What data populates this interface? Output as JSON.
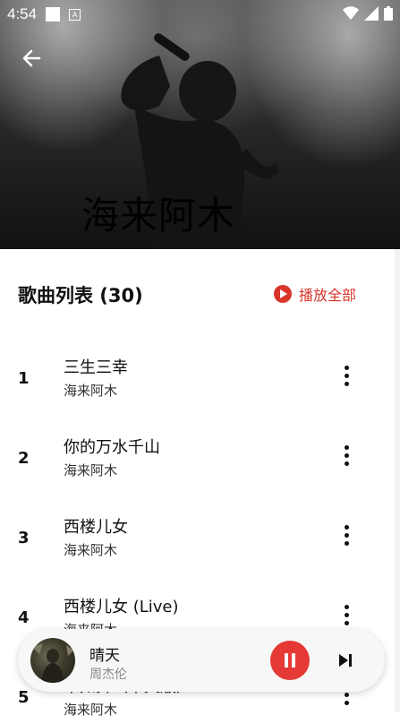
{
  "status_bar": {
    "time": "4:54",
    "notif_letter": "A"
  },
  "header": {
    "artist_name": "海来阿木"
  },
  "list": {
    "title": "歌曲列表 (30)",
    "play_all_label": "播放全部",
    "songs": [
      {
        "index": "1",
        "title": "三生三幸",
        "artist": "海来阿木"
      },
      {
        "index": "2",
        "title": "你的万水千山",
        "artist": "海来阿木"
      },
      {
        "index": "3",
        "title": "西楼儿女",
        "artist": "海来阿木"
      },
      {
        "index": "4",
        "title": "西楼儿女 (Live)",
        "artist": "海来阿木"
      },
      {
        "index": "5",
        "title": "不如舞（中文版）",
        "artist": "海来阿木"
      }
    ]
  },
  "player": {
    "title": "晴天",
    "artist": "周杰伦"
  },
  "colors": {
    "accent": "#d9352b",
    "pause_button": "#e53935"
  },
  "icons": {
    "back": "arrow-left-icon",
    "play_all": "play-circle-icon",
    "more": "more-vert-icon",
    "pause": "pause-icon",
    "next": "skip-next-icon"
  }
}
